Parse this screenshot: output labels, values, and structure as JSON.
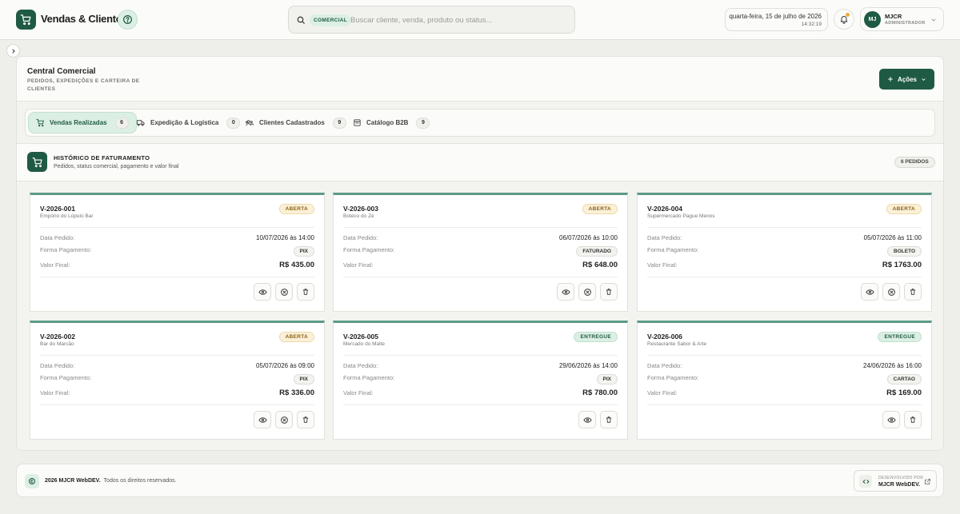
{
  "header": {
    "app_title": "Vendas & Clientes",
    "search": {
      "scope": "COMERCIAL",
      "placeholder": "Buscar cliente, venda, produto ou status..."
    },
    "date_line": "quarta-feira, 15 de julho de 2026",
    "time_line": "14:32:19",
    "user": {
      "initials": "MJ",
      "name": "MJCR",
      "role": "ADMINISTRADOR"
    }
  },
  "panel": {
    "title": "Central Comercial",
    "subtitle": "PEDIDOS, EXPEDIÇÕES E CARTEIRA DE CLIENTES",
    "actions_label": "Ações"
  },
  "tabs": [
    {
      "label": "Vendas Realizadas",
      "count": "6"
    },
    {
      "label": "Expedição & Logística",
      "count": "0"
    },
    {
      "label": "Clientes Cadastrados",
      "count": "9"
    },
    {
      "label": "Catálogo B2B",
      "count": "9"
    }
  ],
  "section": {
    "title": "HISTÓRICO DE FATURAMENTO",
    "subtitle": "Pedidos, status comercial, pagamento e valor final",
    "badge": "6 PEDIDOS"
  },
  "field_labels": {
    "date": "Data Pedido:",
    "payment": "Forma Pagamento:",
    "total": "Valor Final:"
  },
  "orders": [
    {
      "id": "V-2026-001",
      "client": "Empório do Lúpulo Bar",
      "status": "ABERTA",
      "date": "10/07/2026 às 14:00",
      "payment": "PIX",
      "total": "R$ 435.00"
    },
    {
      "id": "V-2026-003",
      "client": "Boteco do Zé",
      "status": "ABERTA",
      "date": "06/07/2026 às 10:00",
      "payment": "FATURADO",
      "total": "R$ 648.00"
    },
    {
      "id": "V-2026-004",
      "client": "Supermercado Pague Menos",
      "status": "ABERTA",
      "date": "05/07/2026 às 11:00",
      "payment": "BOLETO",
      "total": "R$ 1763.00"
    },
    {
      "id": "V-2026-002",
      "client": "Bar do Marcão",
      "status": "ABERTA",
      "date": "05/07/2026 às 09:00",
      "payment": "PIX",
      "total": "R$ 336.00"
    },
    {
      "id": "V-2026-005",
      "client": "Mercado do Malte",
      "status": "ENTREGUE",
      "date": "29/06/2026 às 14:00",
      "payment": "PIX",
      "total": "R$ 780.00"
    },
    {
      "id": "V-2026-006",
      "client": "Restaurante Sabor & Arte",
      "status": "ENTREGUE",
      "date": "24/06/2026 às 16:00",
      "payment": "CARTAO",
      "total": "R$ 169.00"
    }
  ],
  "footer": {
    "brand": "2026 MJCR WebDEV.",
    "rights": "Todos os direitos reservados.",
    "dev_label": "DESENVOLVIDO POR",
    "dev_name": "MJCR WebDEV."
  },
  "colors": {
    "brand": "#1f5a44",
    "accent_light": "#dcefe4",
    "card_top": "#5b9a86",
    "status_open": "#8a6418",
    "notification_dot": "#f0a93a"
  },
  "icons": {
    "logo": "shopping-cart-icon",
    "help": "help-circle-icon",
    "search": "search-icon",
    "bell": "bell-icon",
    "view": "eye-icon",
    "cancel": "x-circle-icon",
    "delete": "trash-icon",
    "code": "code-icon",
    "external": "external-link-icon"
  }
}
